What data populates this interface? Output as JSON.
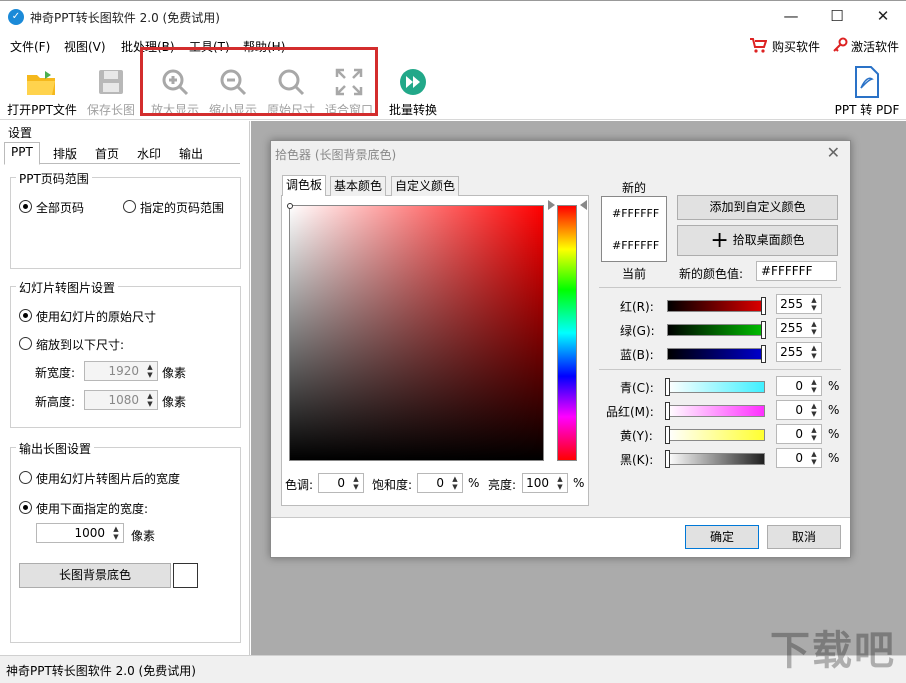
{
  "window": {
    "title": "神奇PPT转长图软件 2.0 (免费试用)",
    "minimize": "—",
    "maximize": "☐",
    "close": "✕"
  },
  "menu": {
    "items": [
      "文件(F)",
      "视图(V)",
      "批处理(B)",
      "工具(T)",
      "帮助(H)"
    ],
    "buy": "购买软件",
    "activate": "激活软件"
  },
  "toolbar": {
    "open": "打开PPT文件",
    "save": "保存长图",
    "zoom_in": "放大显示",
    "zoom_out": "缩小显示",
    "original": "原始尺寸",
    "fit": "适合窗口",
    "batch": "批量转换",
    "pdf": "PPT 转 PDF"
  },
  "settings": {
    "title": "设置",
    "tabs": [
      "PPT",
      "排版",
      "首页",
      "水印",
      "输出"
    ],
    "page_range": {
      "title": "PPT页码范围",
      "all": "全部页码",
      "specified": "指定的页码范围"
    },
    "slide_size": {
      "title": "幻灯片转图片设置",
      "original": "使用幻灯片的原始尺寸",
      "scale": "缩放到以下尺寸:",
      "width_label": "新宽度:",
      "width_value": "1920",
      "height_label": "新高度:",
      "height_value": "1080",
      "unit": "像素"
    },
    "output": {
      "title": "输出长图设置",
      "use_width": "使用幻灯片转图片后的宽度",
      "use_specified": "使用下面指定的宽度:",
      "width_value": "1000",
      "unit": "像素",
      "bg_button": "长图背景底色"
    }
  },
  "status": "神奇PPT转长图软件 2.0 (免费试用)",
  "dialog": {
    "title": "拾色器 (长图背景底色)",
    "tabs": [
      "调色板",
      "基本颜色",
      "自定义颜色"
    ],
    "new_label": "新的",
    "current_label": "当前",
    "new_hex": "#FFFFFF",
    "current_hex": "#FFFFFF",
    "add_custom": "添加到自定义颜色",
    "pick_screen": "拾取桌面颜色",
    "new_value_label": "新的颜色值:",
    "new_value": "#FFFFFF",
    "rgb": [
      {
        "label": "红(R):",
        "value": "255",
        "color": "#e00000"
      },
      {
        "label": "绿(G):",
        "value": "255",
        "color": "#00c000"
      },
      {
        "label": "蓝(B):",
        "value": "255",
        "color": "#0000d0"
      }
    ],
    "cmyk": [
      {
        "label": "青(C):",
        "value": "0",
        "color": "#40f0ff"
      },
      {
        "label": "品红(M):",
        "value": "0",
        "color": "#ff30ff"
      },
      {
        "label": "黄(Y):",
        "value": "0",
        "color": "#ffff30"
      },
      {
        "label": "黑(K):",
        "value": "0",
        "color": "#202020"
      }
    ],
    "percent": "%",
    "hue_label": "色调:",
    "hue_value": "0",
    "sat_label": "饱和度:",
    "sat_value": "0",
    "bright_label": "亮度:",
    "bright_value": "100",
    "ok": "确定",
    "cancel": "取消"
  },
  "watermark": "下载吧"
}
